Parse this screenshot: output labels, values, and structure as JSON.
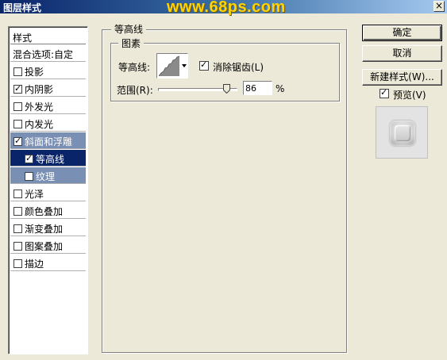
{
  "window": {
    "title": "图层样式",
    "watermark": "www.68ps.com",
    "close_glyph": "×"
  },
  "styles": {
    "header": "样式",
    "blend_options": "混合选项:自定",
    "items": [
      {
        "label": "投影",
        "checked": false
      },
      {
        "label": "内阴影",
        "checked": true
      },
      {
        "label": "外发光",
        "checked": false
      },
      {
        "label": "内发光",
        "checked": false
      },
      {
        "label": "斜面和浮雕",
        "checked": true
      },
      {
        "label": "等高线",
        "checked": true
      },
      {
        "label": "纹理",
        "checked": false
      },
      {
        "label": "光泽",
        "checked": false
      },
      {
        "label": "颜色叠加",
        "checked": false
      },
      {
        "label": "渐变叠加",
        "checked": false
      },
      {
        "label": "图案叠加",
        "checked": false
      },
      {
        "label": "描边",
        "checked": false
      }
    ]
  },
  "contour_panel": {
    "group_title": "等高线",
    "elements_title": "图素",
    "contour_label": "等高线:",
    "anti_alias_label": "消除锯齿(L)",
    "anti_alias_checked": true,
    "range_label": "范围(R):",
    "range_value": "86",
    "range_unit": "%",
    "range_level_percent": 86
  },
  "buttons": {
    "ok": "确定",
    "cancel": "取消",
    "new_style": "新建样式(W)...",
    "preview_label": "预览(V)",
    "preview_checked": true
  },
  "icons": {
    "close": "close-icon",
    "contour_curve": "contour-curve-icon",
    "dropdown": "chevron-down-icon",
    "checkbox_check": "check-icon",
    "slider": "slider-thumb-icon"
  },
  "colors": {
    "title_gradient_start": "#0a246a",
    "title_gradient_end": "#a6caf0",
    "watermark": "#ffd400",
    "selection": "#0a246a",
    "selection_parent": "#7a8fb4",
    "dialog_background": "#ece9d8"
  }
}
